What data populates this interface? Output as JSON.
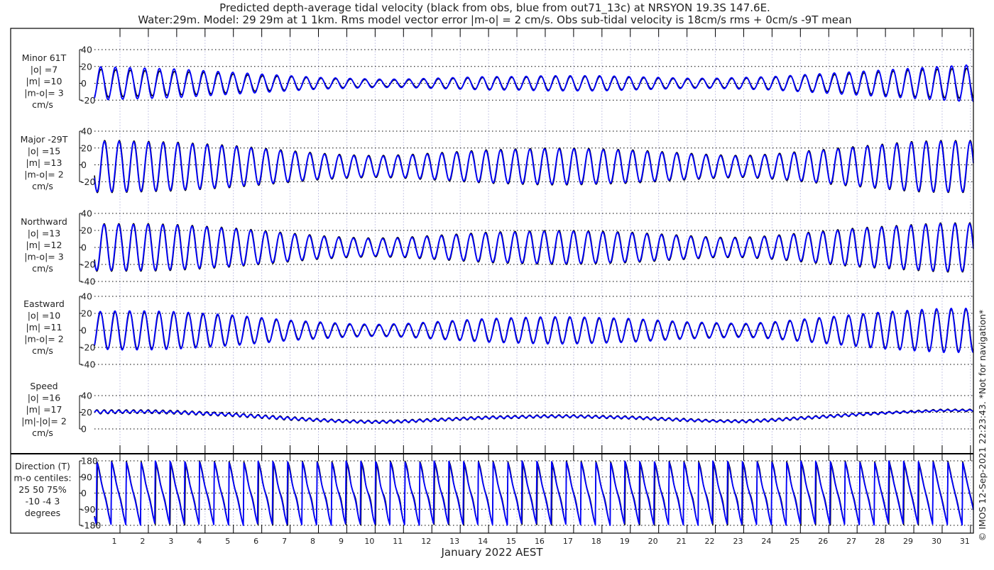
{
  "chart_data": {
    "type": "line",
    "title_line1": "Predicted depth-average tidal velocity (black from obs, blue from out71_13c) at NRSYON 19.3S 147.6E.",
    "title_line2": "Water:29m. Model: 29 29m at 1 1km. Rms model vector error |m-o| = 2 cm/s. Obs sub-tidal velocity is 18cm/s rms + 0cm/s -9T mean",
    "xlabel": "January 2022 AEST",
    "x_ticks": [
      "1",
      "2",
      "3",
      "4",
      "5",
      "6",
      "7",
      "8",
      "9",
      "10",
      "11",
      "12",
      "13",
      "14",
      "15",
      "16",
      "17",
      "18",
      "19",
      "20",
      "21",
      "22",
      "23",
      "24",
      "25",
      "26",
      "27",
      "28",
      "29",
      "30",
      "31"
    ],
    "xlim_days": [
      0.1,
      31.1
    ],
    "tidal_period_hours": 12.42,
    "series_colors": {
      "obs": "#000000",
      "model": "#0000ff"
    },
    "grid": true,
    "panels": [
      {
        "key": "minor",
        "label": [
          "Minor 61T",
          "|o| =7",
          "|m| =10",
          "|m-o|= 3",
          "cm/s"
        ],
        "ylim": [
          -40,
          40
        ],
        "yticks": [
          "40",
          "20",
          "0",
          "-20"
        ],
        "daily_amplitude_model": [
          20,
          19,
          18,
          17,
          15,
          13,
          11,
          9,
          7,
          6,
          5,
          5,
          6,
          7,
          8,
          8,
          9,
          9,
          9,
          8,
          7,
          6,
          6,
          7,
          8,
          10,
          12,
          14,
          16,
          18,
          20,
          22
        ],
        "daily_amplitude_obs": [
          17,
          16,
          15,
          14,
          13,
          11,
          9,
          8,
          6,
          5,
          4,
          4,
          5,
          6,
          7,
          7,
          8,
          8,
          8,
          7,
          6,
          5,
          5,
          6,
          7,
          9,
          10,
          12,
          14,
          16,
          17,
          18
        ]
      },
      {
        "key": "major",
        "label": [
          "Major -29T",
          "|o| =15",
          "|m| =13",
          "|m-o|= 2",
          "cm/s"
        ],
        "ylim": [
          -40,
          40
        ],
        "yticks": [
          "40",
          "20",
          "0",
          "-20"
        ],
        "daily_amplitude_model": [
          30,
          30,
          29,
          28,
          26,
          24,
          21,
          18,
          15,
          13,
          12,
          13,
          15,
          17,
          19,
          20,
          21,
          21,
          20,
          19,
          17,
          15,
          13,
          12,
          14,
          17,
          20,
          23,
          26,
          29,
          30,
          30
        ],
        "daily_amplitude_obs": [
          31,
          31,
          30,
          29,
          27,
          25,
          22,
          19,
          16,
          14,
          13,
          14,
          16,
          18,
          20,
          21,
          22,
          22,
          21,
          20,
          18,
          16,
          14,
          13,
          15,
          18,
          21,
          24,
          27,
          30,
          31,
          31
        ]
      },
      {
        "key": "north",
        "label": [
          "Northward",
          "|o| =13",
          "|m| =12",
          "|m-o|= 3",
          "cm/s"
        ],
        "ylim": [
          -40,
          40
        ],
        "yticks": [
          "40",
          "20",
          "0",
          "-20",
          "-40"
        ],
        "daily_amplitude_model": [
          27,
          27,
          27,
          26,
          24,
          22,
          19,
          16,
          13,
          11,
          10,
          11,
          13,
          15,
          17,
          18,
          19,
          19,
          18,
          17,
          15,
          13,
          11,
          11,
          13,
          16,
          19,
          22,
          24,
          26,
          28,
          28
        ],
        "daily_amplitude_obs": [
          28,
          28,
          28,
          27,
          25,
          23,
          20,
          17,
          14,
          12,
          11,
          12,
          14,
          16,
          18,
          19,
          20,
          20,
          19,
          18,
          16,
          14,
          12,
          12,
          14,
          17,
          20,
          23,
          25,
          27,
          29,
          29
        ]
      },
      {
        "key": "east",
        "label": [
          "Eastward",
          "|o| =10",
          "|m| =11",
          "|m-o|= 2",
          "cm/s"
        ],
        "ylim": [
          -40,
          40
        ],
        "yticks": [
          "40",
          "20",
          "0",
          "-20",
          "-40"
        ],
        "daily_amplitude_model": [
          22,
          23,
          23,
          22,
          20,
          18,
          15,
          12,
          10,
          8,
          7,
          8,
          10,
          12,
          14,
          15,
          16,
          16,
          15,
          14,
          12,
          10,
          9,
          8,
          10,
          13,
          16,
          19,
          22,
          24,
          26,
          26
        ],
        "daily_amplitude_obs": [
          21,
          22,
          22,
          21,
          19,
          17,
          14,
          11,
          9,
          7,
          6,
          7,
          9,
          11,
          13,
          14,
          15,
          15,
          14,
          13,
          11,
          9,
          8,
          7,
          9,
          12,
          15,
          18,
          21,
          23,
          25,
          25
        ]
      },
      {
        "key": "speed",
        "label": [
          "Speed",
          "|o| =16",
          "|m| =17",
          "|m|-|o|= 2",
          "cm/s"
        ],
        "ylim": [
          0,
          40
        ],
        "yticks": [
          "40",
          "20",
          "0"
        ],
        "derived_from": "north,east"
      },
      {
        "key": "direction",
        "label": [
          "Direction (T)",
          "m-o centiles:",
          "25  50  75%",
          "-10 -4  3",
          "degrees"
        ],
        "ylim": [
          -180,
          180
        ],
        "yticks": [
          "180",
          "90",
          "0",
          "-90",
          "-180"
        ],
        "derived_from": "north,east"
      }
    ]
  },
  "copyright": "© IMOS 12-Sep-2021 22:23:43. *Not for navigation*"
}
